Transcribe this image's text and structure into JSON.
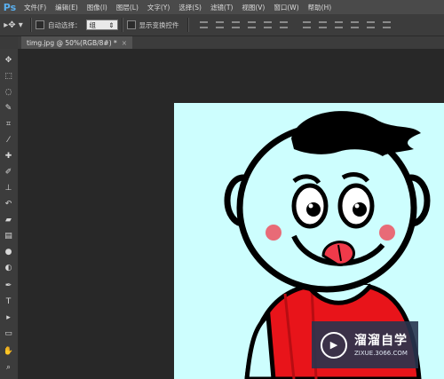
{
  "app": {
    "logo": "Ps"
  },
  "menu": [
    "文件(F)",
    "编辑(E)",
    "图像(I)",
    "图层(L)",
    "文字(Y)",
    "选择(S)",
    "滤镜(T)",
    "视图(V)",
    "窗口(W)",
    "帮助(H)"
  ],
  "options": {
    "tool_icon": "move-tool-icon",
    "auto_select_label": "自动选择：",
    "auto_select_value": "组",
    "show_transform_label": "显示变换控件"
  },
  "document": {
    "tab_title": "timg.jpg @ 50%(RGB/8#) *",
    "close": "×"
  },
  "tools": [
    "move-icon",
    "marquee-icon",
    "lasso-icon",
    "quick-select-icon",
    "crop-icon",
    "eyedropper-icon",
    "healing-brush-icon",
    "brush-icon",
    "clone-stamp-icon",
    "history-brush-icon",
    "eraser-icon",
    "gradient-icon",
    "blur-icon",
    "dodge-icon",
    "pen-icon",
    "type-icon",
    "path-select-icon",
    "shape-icon",
    "hand-icon",
    "zoom-icon"
  ],
  "watermark": {
    "title": "溜溜自学",
    "url": "ZIXUE.3066.COM"
  },
  "colors": {
    "canvas_bg": "#cdfefe",
    "shirt": "#e8141a",
    "face": "#cdfefe",
    "accent": "#5ab0f0"
  }
}
